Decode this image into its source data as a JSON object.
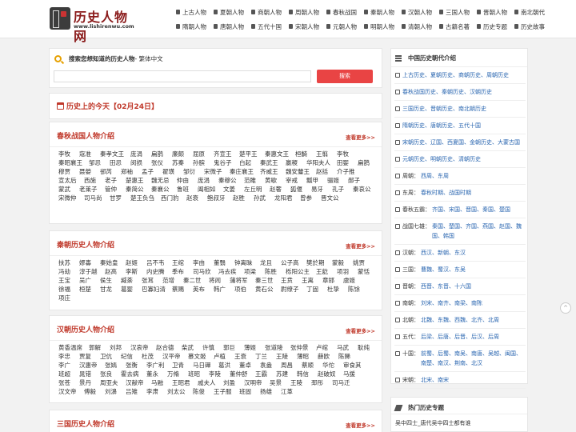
{
  "header": {
    "logo_title": "历史人物网",
    "logo_url": "www.lishirenwu.com",
    "nav_row1": [
      "上古人物",
      "夏朝人物",
      "商朝人物",
      "周朝人物",
      "春秋战国",
      "秦朝人物",
      "汉朝人物",
      "三国人物",
      "晋朝人物",
      "南北朝代"
    ],
    "nav_row2": [
      "隋朝人物",
      "唐朝人物",
      "五代十国",
      "宋朝人物",
      "元朝人物",
      "明朝人物",
      "清朝人物",
      "古籍名著",
      "历史专题",
      "历史故事"
    ]
  },
  "search": {
    "title": "搜索您想知道的历史人物",
    "subtitle": "- 繁体中文",
    "placeholder": "",
    "button": "搜索"
  },
  "today": {
    "title": "历史上的今天【02月24日】"
  },
  "sections": [
    {
      "title": "春秋战国人物介绍",
      "more": "查看更多>>",
      "names": [
        "李牧",
        "寇准",
        "秦孝文王",
        "庞涓",
        "扁鹊",
        "廉颇",
        "屈原",
        "齐宣王",
        "楚平王",
        "秦惠文王",
        "桓齮",
        "王翦",
        "李牧",
        "秦昭襄王",
        "邹忌",
        "田忌",
        "闵损",
        "张仪",
        "苏秦",
        "孙膑",
        "鬼谷子",
        "白起",
        "秦武王",
        "嬴稷",
        "华阳夫人",
        "田婴",
        "扁鹊",
        "穆贾",
        "聂嫈",
        "郤芮",
        "郑袖",
        "孟子",
        "翟璜",
        "邹衍",
        "宋微子",
        "秦庄襄王",
        "齐威王",
        "魏安釐王",
        "赵括",
        "介子推",
        "宣太后",
        "西施",
        "老子",
        "楚惠王",
        "魏无忌",
        "仲由",
        "庞涓",
        "秦穆公",
        "范雎",
        "黄歇",
        "宰戒",
        "瓢甲",
        "骊姬",
        "郧子",
        "蒙武",
        "老莱子",
        "管仲",
        "秦简公",
        "秦襄公",
        "鲁班",
        "阖相如",
        "文姜",
        "左丘明",
        "赵奢",
        "狐偃",
        "易牙",
        "孔子",
        "秦哀公",
        "宋微仲",
        "司马尚",
        "甘罗",
        "楚王负刍",
        "西门豹",
        "赵衰",
        "鲍叔牙",
        "赵胜",
        "孙武",
        "龙阳君",
        "曾参",
        "晋文公"
      ]
    },
    {
      "title": "秦朝历史人物介绍",
      "more": "查看更多>>",
      "names": [
        "扶苏",
        "嫪毐",
        "秦始皇",
        "赵姬",
        "吕不韦",
        "王绾",
        "李由",
        "董翳",
        "钟离昧",
        "龙且",
        "公子高",
        "樊於期",
        "蒙毅",
        "姚贾",
        "冯劫",
        "淳于越",
        "赵高",
        "李斯",
        "内史腾",
        "季布",
        "司马欣",
        "冯去疾",
        "项梁",
        "陈胜",
        "栎阳公主",
        "王龁",
        "项羽",
        "蒙恬",
        "王宝",
        "吴广",
        "侯生",
        "臧荼",
        "张耳",
        "范增",
        "秦二世",
        "将闾",
        "蒲将军",
        "秦三世",
        "王贲",
        "王离",
        "章邯",
        "虞姬",
        "徐福",
        "桓楚",
        "甘龙",
        "葛婴",
        "巴寡妇清",
        "蔡赐",
        "英布",
        "韩广",
        "项伯",
        "黄石公",
        "尉缭子",
        "丁固",
        "杜挚",
        "陈馀",
        "项庄"
      ]
    },
    {
      "title": "汉朝历史人物介绍",
      "more": "查看更多>>",
      "names": [
        "黄香温席",
        "郭解",
        "刘邦",
        "汉哀帝",
        "赵合德",
        "柴武",
        "许慎",
        "郭巨",
        "薄姬",
        "张道陵",
        "张仲景",
        "卢绾",
        "马武",
        "耿纯",
        "李忠",
        "贾复",
        "卫伉",
        "纪信",
        "杜茂",
        "汉平帝",
        "慕文姬",
        "卢植",
        "王衰",
        "丁兰",
        "王陵",
        "薄昭",
        "薛欧",
        "陈豨",
        "李广",
        "汉惠帝",
        "张嫣",
        "张衡",
        "李广利",
        "卫青",
        "马日磾",
        "葛洪",
        "董卓",
        "袁盎",
        "周昌",
        "蔡顺",
        "华佗",
        "审食其",
        "班超",
        "晁错",
        "张良",
        "霍去病",
        "董永",
        "万脩",
        "班昭",
        "李陵",
        "董仲舒",
        "王霸",
        "苏建",
        "韩信",
        "赵破奴",
        "马援",
        "张苍",
        "景丹",
        "周亚夫",
        "汉献帝",
        "马融",
        "王昭君",
        "戚夫人",
        "刘盈",
        "汉明帝",
        "吴景",
        "王陵",
        "邳彤",
        "司马迁",
        "汉文帝",
        "傅毅",
        "刘濞",
        "吕雉",
        "李肃",
        "刘太公",
        "陈俊",
        "王子服",
        "班固",
        "扬雄",
        "江革"
      ]
    },
    {
      "title": "三国历史人物介绍",
      "more": "查看更多>>",
      "names": []
    }
  ],
  "sidebar": {
    "title": "中国历史朝代介绍",
    "items": [
      {
        "pre": "",
        "val": "上古历史、夏朝历史、商朝历史、周朝历史"
      },
      {
        "pre": "",
        "val": "春秋战国历史、秦朝历史、汉朝历史"
      },
      {
        "pre": "",
        "val": "三国历史、晋朝历史、南北朝历史"
      },
      {
        "pre": "",
        "val": "隋朝历史、唐朝历史、五代十国"
      },
      {
        "pre": "",
        "val": "宋朝历史、辽国、西夏国、金朝历史、大蒙古国"
      },
      {
        "pre": "",
        "val": "元朝历史、明朝历史、清朝历史"
      },
      {
        "pre": "周朝：",
        "val": "西周、东周"
      },
      {
        "pre": "东周：",
        "val": "春秋时期、战国时期"
      },
      {
        "pre": "春秋五霸：",
        "val": "齐国、宋国、晋国、秦国、楚国"
      },
      {
        "pre": "战国七雄：",
        "val": "秦国、楚国、齐国、燕国、赵国、魏国、韩国"
      },
      {
        "pre": "汉朝：",
        "val": "西汉、新朝、东汉"
      },
      {
        "pre": "三国：",
        "val": "曹魏、蜀汉、东吴"
      },
      {
        "pre": "晋朝：",
        "val": "西晋、东晋、十六国"
      },
      {
        "pre": "南朝：",
        "val": "刘宋、南齐、南梁、南陈"
      },
      {
        "pre": "北朝：",
        "val": "北魏、东魏、西魏、北齐、北周"
      },
      {
        "pre": "五代：",
        "val": "后梁、后唐、后晋、后汉、后周"
      },
      {
        "pre": "十国：",
        "val": "前蜀、后蜀、南吴、南唐、吴越、闽国、南楚、南汉、荆南、北汉"
      },
      {
        "pre": "宋朝：",
        "val": "北宋、南宋"
      }
    ]
  },
  "hot": {
    "title": "热门历史专题",
    "item": "吴中四士_唐代吴中四士都有谁"
  },
  "totop": "^"
}
